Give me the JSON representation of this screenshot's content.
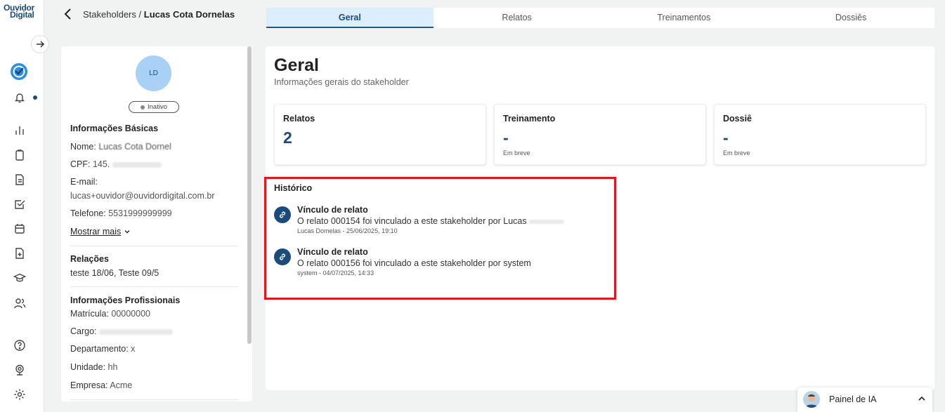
{
  "logo": {
    "line1": "Ouvidor",
    "line2": "Digital"
  },
  "rail": {
    "icons": [
      "expand-arrow-icon",
      "brand-check-icon",
      "bell-icon",
      "chart-icon",
      "clipboard-icon",
      "document-icon",
      "checkbox-icon",
      "calendar-icon",
      "file-plus-icon",
      "graduation-cap-icon",
      "users-icon",
      "help-icon",
      "webcam-icon",
      "gear-icon"
    ]
  },
  "breadcrumb": {
    "parent": "Stakeholders",
    "separator": "/",
    "current": "Lucas Cota Dornelas"
  },
  "tabs": [
    {
      "label": "Geral",
      "active": true
    },
    {
      "label": "Relatos",
      "active": false
    },
    {
      "label": "Treinamentos",
      "active": false
    },
    {
      "label": "Dossiês",
      "active": false
    }
  ],
  "profile": {
    "initials": "LD",
    "status": "Inativo",
    "basic_title": "Informações Básicas",
    "name_label": "Nome:",
    "name_value": "Lucas Cota Dornel",
    "cpf_label": "CPF:",
    "cpf_value": "145.",
    "email_label": "E-mail:",
    "email_value": "lucas+ouvidor@ouvidordigital.com.br",
    "phone_label": "Telefone:",
    "phone_value": "5531999999999",
    "show_more": "Mostrar mais",
    "relations_title": "Relações",
    "relations_value": "teste 18/06, Teste 09/5",
    "prof_title": "Informações Profissionais",
    "registration_label": "Matrícula:",
    "registration_value": "00000000",
    "role_label": "Cargo:",
    "department_label": "Departamento:",
    "department_value": "x",
    "unit_label": "Unidade:",
    "unit_value": "hh",
    "company_label": "Empresa:",
    "company_value": "Acme"
  },
  "main": {
    "title": "Geral",
    "subtitle": "Informações gerais do stakeholder",
    "cards": [
      {
        "title": "Relatos",
        "value": "2",
        "sub": ""
      },
      {
        "title": "Treinamento",
        "value": "-",
        "sub": "Em breve"
      },
      {
        "title": "Dossiê",
        "value": "-",
        "sub": "Em breve"
      }
    ],
    "history_title": "Histórico",
    "history": [
      {
        "head": "Vínculo de relato",
        "desc": "O relato 000154 foi vinculado a este stakeholder por Lucas",
        "meta": "Lucas Domelas - 25/06/2025, 19:10"
      },
      {
        "head": "Vínculo de relato",
        "desc": "O relato 000156 foi vinculado a este stakeholder por system",
        "meta": "system - 04/07/2025, 14:33"
      }
    ]
  },
  "ai_panel": {
    "label": "Painel de IA"
  },
  "colors": {
    "brand": "#1a4b7a",
    "highlight": "#e0161a",
    "active_tab_bg": "#dcedfb"
  }
}
